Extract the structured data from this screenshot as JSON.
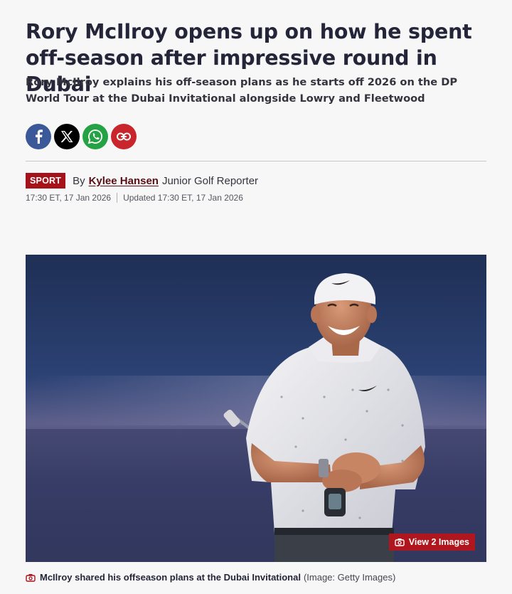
{
  "article": {
    "headline": "Rory McIlroy opens up on how he spent off-season after impressive round in Dubai",
    "standfirst": "Rory McIlroy explains his off-season plans as he starts off 2026 on the DP World Tour at the Dubai Invitational alongside Lowry and Fleetwood"
  },
  "share": {
    "buttons": [
      {
        "name": "facebook",
        "icon": "facebook-icon"
      },
      {
        "name": "x",
        "icon": "x-icon"
      },
      {
        "name": "whatsapp",
        "icon": "whatsapp-icon"
      },
      {
        "name": "copy-link",
        "icon": "link-icon"
      }
    ]
  },
  "byline": {
    "section": "SPORT",
    "by": "By",
    "author": "Kylee Hansen",
    "role": "Junior Golf Reporter",
    "published": "17:30 ET, 17 Jan 2026",
    "updated": "Updated 17:30 ET, 17 Jan 2026"
  },
  "image": {
    "view_label": "View 2 Images",
    "caption": "McIlroy shared his offseason plans at the Dubai Invitational",
    "credit": "(Image: Getty Images)"
  },
  "colors": {
    "brand_red": "#a5121a",
    "facebook": "#3b5998",
    "whatsapp": "#25a244"
  }
}
